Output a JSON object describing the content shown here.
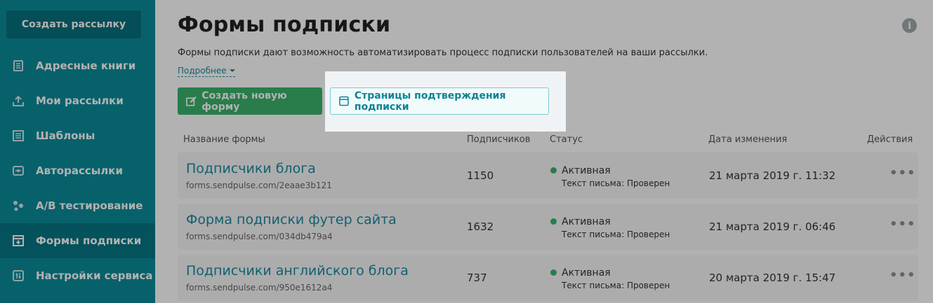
{
  "sidebar": {
    "create_button": "Создать рассылку",
    "items": [
      {
        "label": "Адресные книги",
        "icon": "address-book-icon",
        "active": false
      },
      {
        "label": "Мои рассылки",
        "icon": "send-icon",
        "active": false
      },
      {
        "label": "Шаблоны",
        "icon": "template-icon",
        "active": false
      },
      {
        "label": "Авторассылки",
        "icon": "automation-icon",
        "active": false
      },
      {
        "label": "A/B тестирование",
        "icon": "ab-test-icon",
        "active": false
      },
      {
        "label": "Формы подписки",
        "icon": "form-icon",
        "active": true
      },
      {
        "label": "Настройки сервиса",
        "icon": "settings-icon",
        "active": false
      }
    ]
  },
  "main": {
    "title": "Формы подписки",
    "description": "Формы подписки дают возможность автоматизировать процесс подписки пользователей на ваши рассылки.",
    "more_link": "Подробнее",
    "new_form_button": "Создать новую форму",
    "confirm_pages_button": "Страницы подтверждения подписки"
  },
  "table": {
    "headers": {
      "name": "Название формы",
      "subscribers": "Подписчиков",
      "status": "Статус",
      "date": "Дата изменения",
      "actions": "Действия"
    },
    "rows": [
      {
        "name": "Подписчики блога",
        "url": "forms.sendpulse.com/2eaae3b121",
        "subscribers": "1150",
        "status": "Активная",
        "status_sub": "Текст письма: Проверен",
        "date": "21 марта 2019 г. 11:32",
        "actions": "•••"
      },
      {
        "name": "Форма подписки футер сайта",
        "url": "forms.sendpulse.com/034db479a4",
        "subscribers": "1632",
        "status": "Активная",
        "status_sub": "Текст письма: Проверен",
        "date": "21 марта 2019 г. 06:46",
        "actions": "•••"
      },
      {
        "name": "Подписчики английского блога",
        "url": "forms.sendpulse.com/950e1612a4",
        "subscribers": "737",
        "status": "Активная",
        "status_sub": "Текст письма: Проверен",
        "date": "20 марта 2019 г. 15:47",
        "actions": "•••"
      }
    ]
  },
  "colors": {
    "sidebar": "#0b8b9a",
    "accent": "#1a8aa0",
    "green": "#3ab36a"
  }
}
